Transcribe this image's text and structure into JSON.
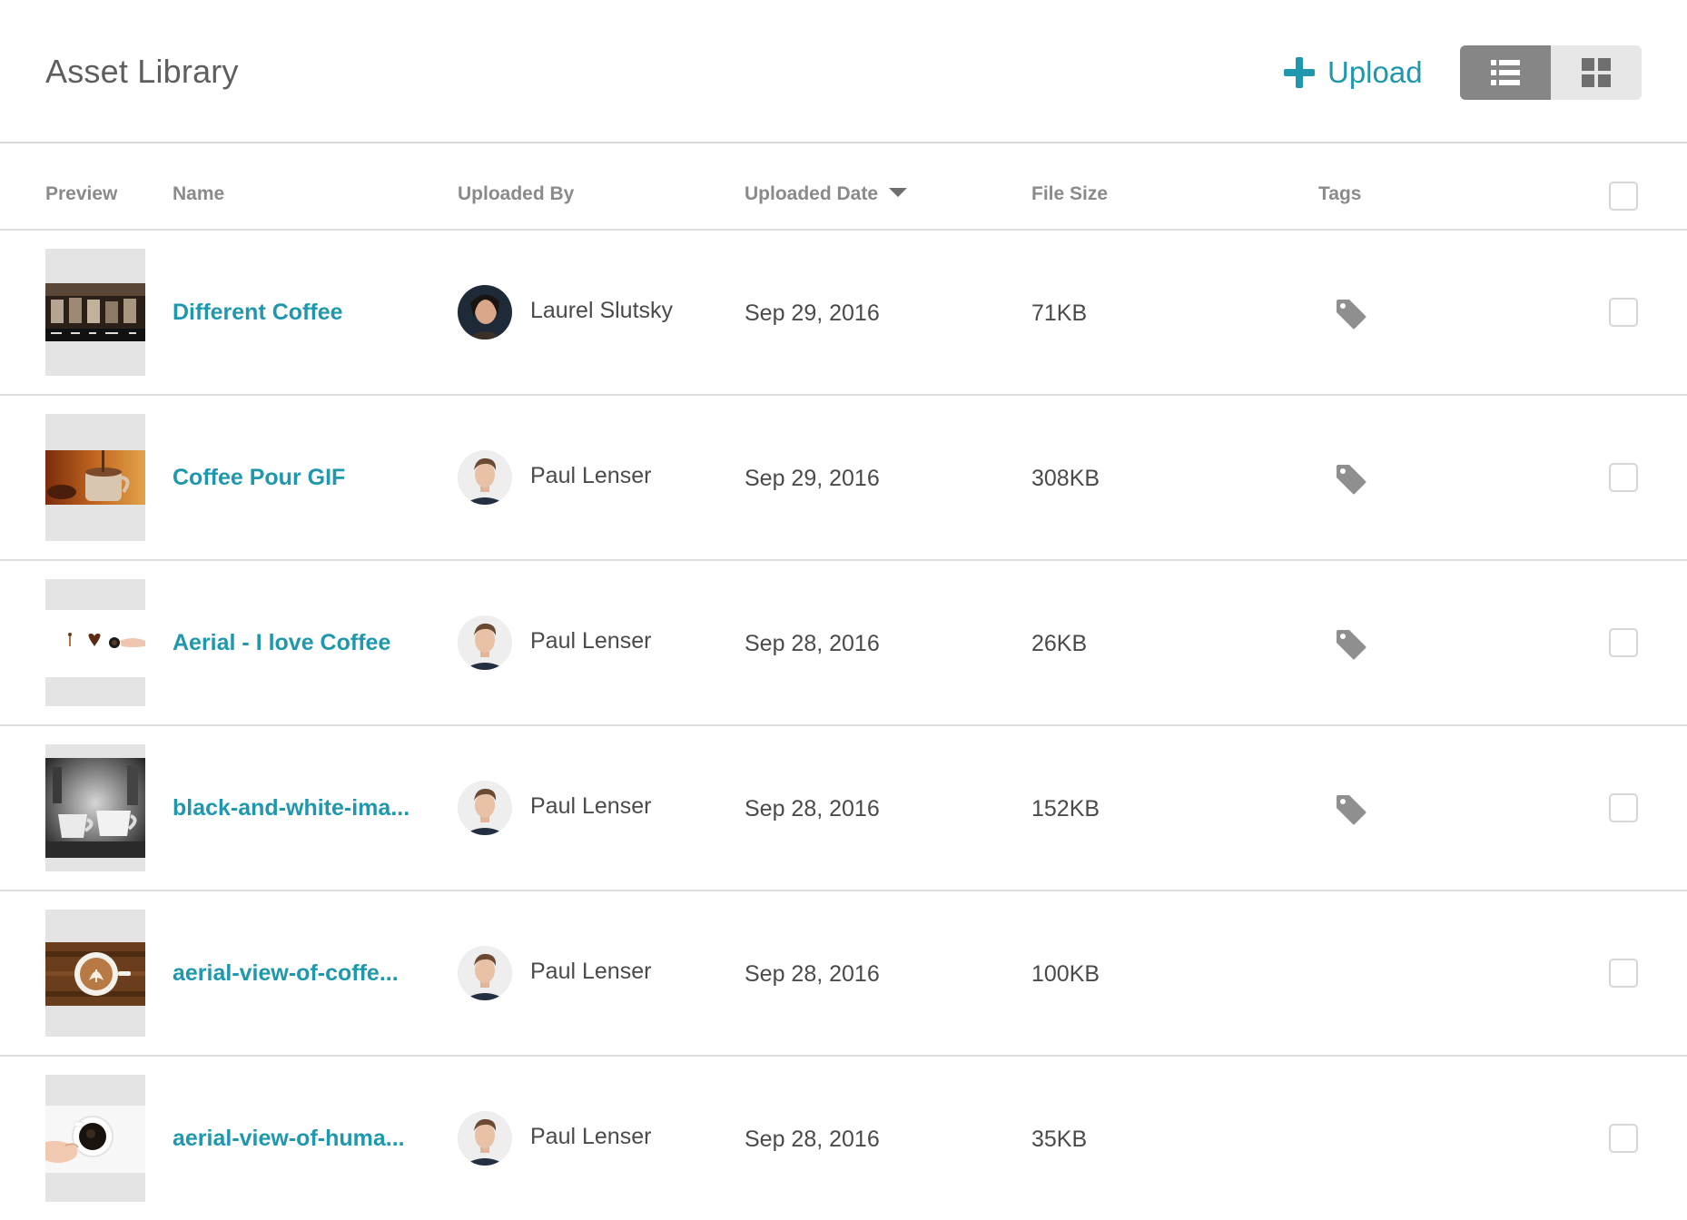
{
  "header": {
    "title": "Asset Library",
    "upload_label": "Upload",
    "view_modes": [
      "list",
      "grid"
    ],
    "active_view": "list"
  },
  "columns": {
    "preview": "Preview",
    "name": "Name",
    "uploaded_by": "Uploaded By",
    "uploaded_date": "Uploaded Date",
    "file_size": "File Size",
    "tags": "Tags"
  },
  "sort": {
    "column": "uploaded_date",
    "direction": "descending"
  },
  "colors": {
    "accent": "#1f97ad",
    "toggle_active": "#868686",
    "toggle_inactive": "#e7e7e7",
    "tag_icon": "#8f8f8f"
  },
  "rows": [
    {
      "name": "Different Coffee",
      "uploaded_by": "Laurel Slutsky",
      "date": "Sep 29, 2016",
      "size": "71KB",
      "has_tags": true,
      "preview": "coffee-cups-menu"
    },
    {
      "name": "Coffee Pour GIF",
      "uploaded_by": "Paul Lenser",
      "date": "Sep 29, 2016",
      "size": "308KB",
      "has_tags": true,
      "preview": "coffee-pour"
    },
    {
      "name": "Aerial - I love Coffee",
      "uploaded_by": "Paul Lenser",
      "date": "Sep 28, 2016",
      "size": "26KB",
      "has_tags": true,
      "preview": "i-love-coffee"
    },
    {
      "name": "black-and-white-ima...",
      "uploaded_by": "Paul Lenser",
      "date": "Sep 28, 2016",
      "size": "152KB",
      "has_tags": true,
      "preview": "black-and-white-cups"
    },
    {
      "name": "aerial-view-of-coffe...",
      "uploaded_by": "Paul Lenser",
      "date": "Sep 28, 2016",
      "size": "100KB",
      "has_tags": false,
      "preview": "latte-art"
    },
    {
      "name": "aerial-view-of-huma...",
      "uploaded_by": "Paul Lenser",
      "date": "Sep 28, 2016",
      "size": "35KB",
      "has_tags": false,
      "preview": "hand-holding-cup"
    }
  ]
}
